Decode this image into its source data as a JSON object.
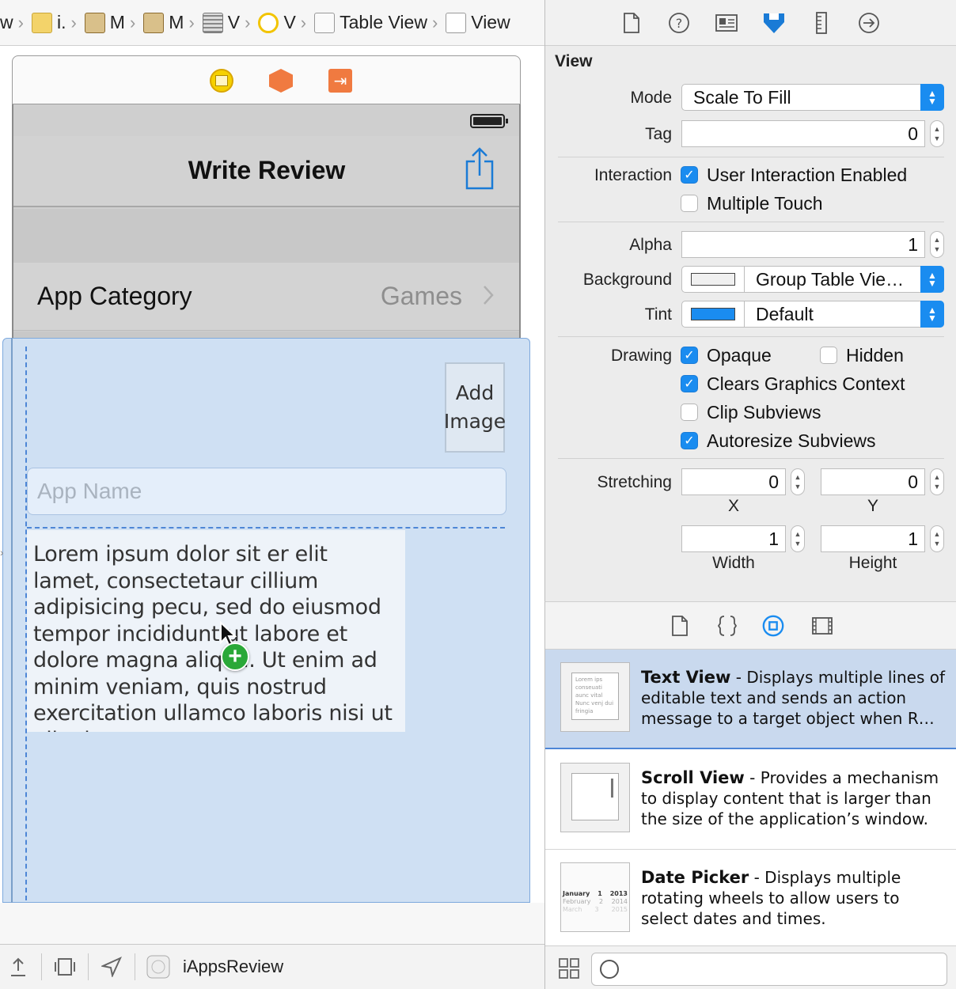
{
  "jump_bar": {
    "crumbs": [
      "w",
      "i.",
      "M",
      "M",
      "V",
      "V",
      "Table View",
      "View"
    ]
  },
  "scene": {
    "nav_title": "Write Review",
    "category_label": "App Category",
    "category_value": "Games",
    "add_image_label_1": "Add",
    "add_image_label_2": "Image",
    "app_name_placeholder": "App Name",
    "review_text": "Lorem ipsum dolor sit er elit lamet, consectetaur cillium adipisicing pecu, sed do eiusmod tempor incididunt ut labore et dolore magna aliqua. Ut enim ad minim veniam, quis nostrud exercitation ullamco laboris nisi ut aliquip ex ea"
  },
  "canvas_toolbar": {
    "scheme_label": "iAppsReview"
  },
  "inspector": {
    "section_title": "View",
    "mode": {
      "label": "Mode",
      "value": "Scale To Fill"
    },
    "tag": {
      "label": "Tag",
      "value": "0"
    },
    "interaction": {
      "label": "Interaction",
      "user_interaction": {
        "label": "User Interaction Enabled",
        "checked": true
      },
      "multiple_touch": {
        "label": "Multiple Touch",
        "checked": false
      }
    },
    "alpha": {
      "label": "Alpha",
      "value": "1"
    },
    "background": {
      "label": "Background",
      "value": "Group Table Vie…",
      "swatch": "#f0f0f0"
    },
    "tint": {
      "label": "Tint",
      "value": "Default",
      "swatch": "#1a8cf0"
    },
    "drawing": {
      "label": "Drawing",
      "opaque": {
        "label": "Opaque",
        "checked": true
      },
      "hidden": {
        "label": "Hidden",
        "checked": false
      },
      "clears": {
        "label": "Clears Graphics Context",
        "checked": true
      },
      "clip": {
        "label": "Clip Subviews",
        "checked": false
      },
      "autoresize": {
        "label": "Autoresize Subviews",
        "checked": true
      }
    },
    "stretching": {
      "label": "Stretching",
      "x": "0",
      "y": "0",
      "width": "1",
      "height": "1",
      "x_label": "X",
      "y_label": "Y",
      "width_label": "Width",
      "height_label": "Height"
    }
  },
  "library": {
    "items": [
      {
        "title": "Text View",
        "desc": " - Displays multiple lines of editable text and sends an action message to a target object when R…",
        "thumb_text": "Lorem ips conseuati aunc vital Nunc venj dui fringia"
      },
      {
        "title": "Scroll View",
        "desc": " - Provides a mechanism to display content that is larger than the size of the application’s window."
      },
      {
        "title": "Date Picker",
        "desc": " - Displays multiple rotating wheels to allow users to select dates and times.",
        "thumb_rows": [
          "January",
          "1",
          "2013",
          "February",
          "2",
          "2014",
          "March",
          "3",
          "2015"
        ]
      }
    ]
  },
  "colors": {
    "accent": "#1a8cf0",
    "selection": "#cfe0f3"
  }
}
